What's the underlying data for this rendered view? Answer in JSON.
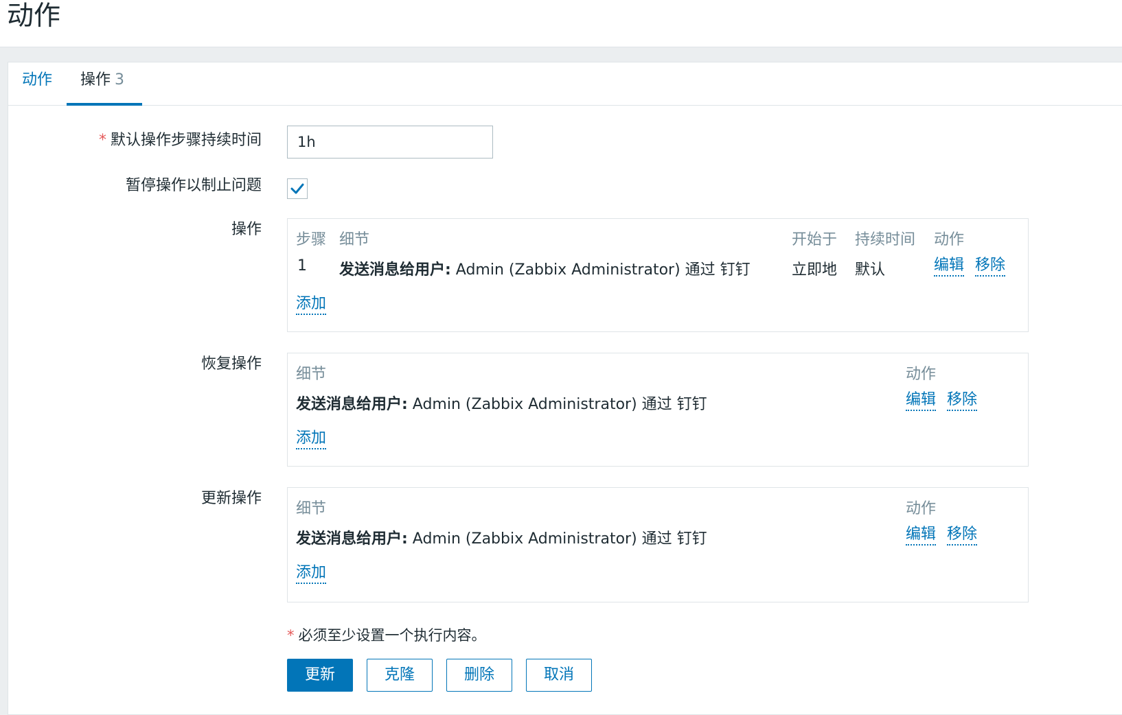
{
  "page": {
    "title": "动作"
  },
  "tabs": [
    {
      "label": "动作"
    },
    {
      "label": "操作",
      "count": "3"
    }
  ],
  "form": {
    "default_step_duration": {
      "label": "默认操作步骤持续时间",
      "value": "1h"
    },
    "pause_operations": {
      "label": "暂停操作以制止问题",
      "checked": true
    },
    "operations": {
      "label": "操作",
      "headers": [
        "步骤",
        "细节",
        "开始于",
        "持续时间",
        "动作"
      ],
      "rows": [
        {
          "step": "1",
          "detail_bold": "发送消息给用户:",
          "detail_rest": " Admin (Zabbix Administrator) 通过 钉钉",
          "start": "立即地",
          "duration": "默认",
          "edit": "编辑",
          "remove": "移除"
        }
      ],
      "add": "添加"
    },
    "recovery_operations": {
      "label": "恢复操作",
      "headers": [
        "细节",
        "动作"
      ],
      "rows": [
        {
          "detail_bold": "发送消息给用户:",
          "detail_rest": " Admin (Zabbix Administrator) 通过 钉钉",
          "edit": "编辑",
          "remove": "移除"
        }
      ],
      "add": "添加"
    },
    "update_operations": {
      "label": "更新操作",
      "headers": [
        "细节",
        "动作"
      ],
      "rows": [
        {
          "detail_bold": "发送消息给用户:",
          "detail_rest": " Admin (Zabbix Administrator) 通过 钉钉",
          "edit": "编辑",
          "remove": "移除"
        }
      ],
      "add": "添加"
    },
    "required_note": "必须至少设置一个执行内容。",
    "required_mark": "*"
  },
  "buttons": {
    "update": "更新",
    "clone": "克隆",
    "delete": "删除",
    "cancel": "取消"
  },
  "colors": {
    "accent": "#0275b8",
    "required": "#e45959",
    "muted": "#768d99"
  }
}
